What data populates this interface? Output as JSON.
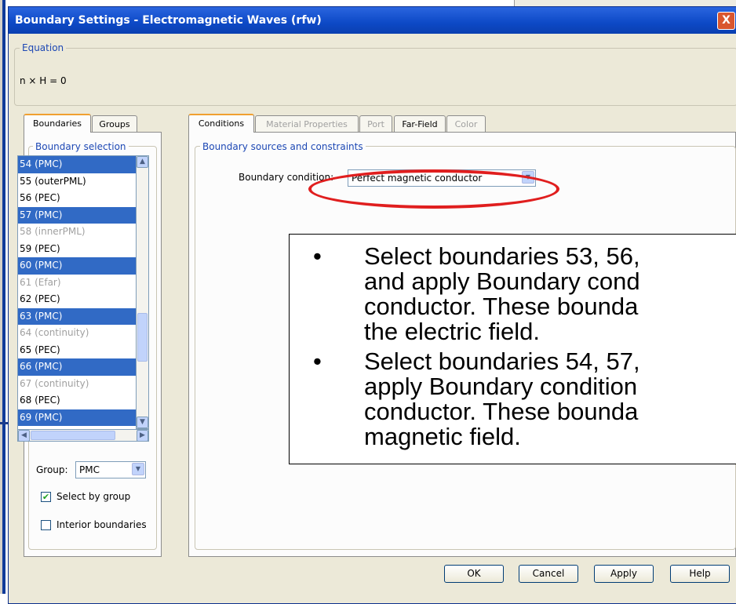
{
  "dialog": {
    "title": "Boundary Settings - Electromagnetic Waves (rfw)",
    "close_label": "X"
  },
  "equation": {
    "legend": "Equation",
    "text": "n × H = 0"
  },
  "left_tabs": [
    "Boundaries",
    "Groups"
  ],
  "boundary_selection": {
    "legend": "Boundary selection",
    "items": [
      {
        "label": "54 (PMC)",
        "selected": true,
        "disabled": false
      },
      {
        "label": "55 (outerPML)",
        "selected": false,
        "disabled": false
      },
      {
        "label": "56 (PEC)",
        "selected": false,
        "disabled": false
      },
      {
        "label": "57 (PMC)",
        "selected": true,
        "disabled": false
      },
      {
        "label": "58 (innerPML)",
        "selected": false,
        "disabled": true
      },
      {
        "label": "59 (PEC)",
        "selected": false,
        "disabled": false
      },
      {
        "label": "60 (PMC)",
        "selected": true,
        "disabled": false
      },
      {
        "label": "61 (Efar)",
        "selected": false,
        "disabled": true
      },
      {
        "label": "62 (PEC)",
        "selected": false,
        "disabled": false
      },
      {
        "label": "63 (PMC)",
        "selected": true,
        "disabled": false
      },
      {
        "label": "64 (continuity)",
        "selected": false,
        "disabled": true
      },
      {
        "label": "65 (PEC)",
        "selected": false,
        "disabled": false
      },
      {
        "label": "66 (PMC)",
        "selected": true,
        "disabled": false
      },
      {
        "label": "67 (continuity)",
        "selected": false,
        "disabled": true
      },
      {
        "label": "68 (PEC)",
        "selected": false,
        "disabled": false
      },
      {
        "label": "69 (PMC)",
        "selected": true,
        "disabled": false
      }
    ],
    "group_label": "Group:",
    "group_value": "PMC",
    "select_by_group_label": "Select by group",
    "select_by_group_checked": true,
    "interior_boundaries_label": "Interior boundaries",
    "interior_boundaries_checked": false
  },
  "right_tabs": [
    "Conditions",
    "Material Properties",
    "Port",
    "Far-Field",
    "Color"
  ],
  "conditions": {
    "legend": "Boundary sources and constraints",
    "boundary_condition_label": "Boundary condition:",
    "boundary_condition_value": "Perfect magnetic conductor"
  },
  "buttons": {
    "ok": "OK",
    "cancel": "Cancel",
    "apply": "Apply",
    "help": "Help"
  },
  "annotation": {
    "bullet1": [
      "Select boundaries 53, 56,",
      "and apply Boundary cond",
      "conductor. These bounda",
      "the electric field."
    ],
    "bullet2": [
      "Select boundaries 54, 57,",
      "apply Boundary condition",
      "conductor. These bounda",
      "magnetic field."
    ]
  },
  "colors": {
    "title_bar": "#0d49c6",
    "selection": "#316ac5",
    "highlight_ellipse": "#e01e1e",
    "dialog_face": "#ece9d8"
  }
}
